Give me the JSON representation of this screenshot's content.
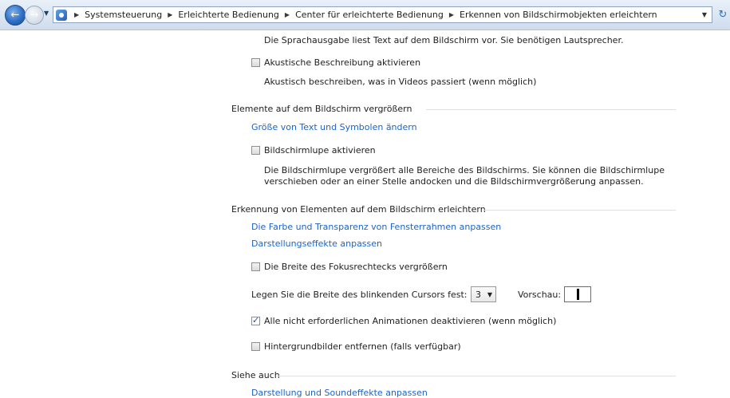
{
  "breadcrumb": [
    "Systemsteuerung",
    "Erleichterte Bedienung",
    "Center für erleichterte Bedienung",
    "Erkennen von Bildschirmobjekten erleichtern"
  ],
  "icons": {
    "back": "back-arrow-icon",
    "forward": "forward-arrow-icon",
    "control_panel": "control-panel-icon",
    "refresh": "refresh-icon"
  },
  "colors": {
    "link": "#1c64c8",
    "text": "#1e1e1e",
    "separator": "#dcdfe4"
  },
  "narrator_desc": "Die Sprachausgabe liest Text auf dem Bildschirm vor. Sie benötigen Lautsprecher.",
  "audio_description": {
    "label": "Akustische Beschreibung aktivieren",
    "checked": false,
    "desc": "Akustisch beschreiben, was in Videos passiert (wenn möglich)"
  },
  "enlarge": {
    "heading": "Elemente auf dem Bildschirm vergrößern",
    "link_text_size": "Größe von Text und Symbolen ändern",
    "magnifier_label": "Bildschirmlupe aktivieren",
    "magnifier_checked": false,
    "magnifier_desc_1": "Die Bildschirmlupe vergrößert alle Bereiche des Bildschirms. Sie können die Bildschirmlupe",
    "magnifier_desc_2": "verschieben oder an einer Stelle andocken und die Bildschirmvergrößerung anpassen."
  },
  "recognize": {
    "heading": "Erkennung von Elementen auf dem Bildschirm erleichtern",
    "link_window_color": "Die Farbe und Transparenz von Fensterrahmen anpassen",
    "link_effects": "Darstellungseffekte anpassen",
    "focus_label": "Die Breite des Fokusrechtecks vergrößern",
    "focus_checked": false,
    "cursor_label": "Legen Sie die Breite des blinkenden Cursors fest:",
    "cursor_width": "3",
    "preview_label": "Vorschau:",
    "animations_label": "Alle nicht erforderlichen Animationen deaktivieren (wenn möglich)",
    "animations_checked": true,
    "background_label": "Hintergrundbilder entfernen (falls verfügbar)",
    "background_checked": false
  },
  "see_also": {
    "heading": "Siehe auch",
    "link_sound": "Darstellung und Soundeffekte anpassen"
  }
}
